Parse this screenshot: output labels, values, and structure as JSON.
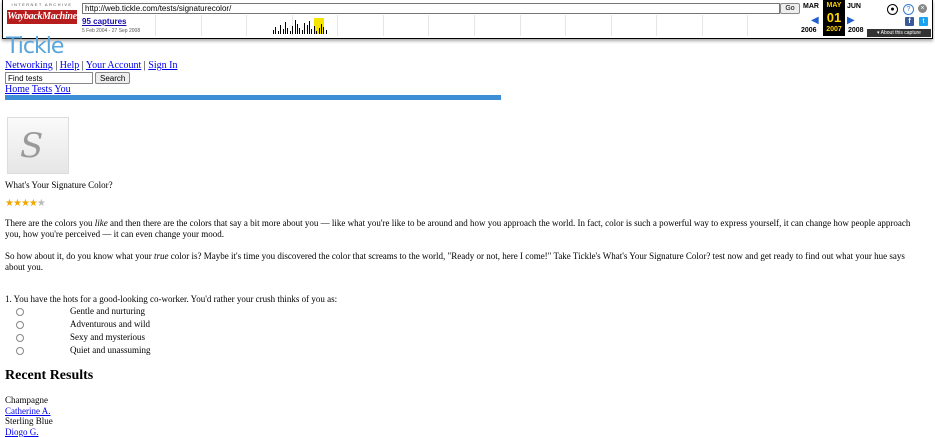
{
  "wayback": {
    "logo_top": "INTERNET ARCHIVE",
    "logo_main": "WaybackMachine",
    "url": "http://web.tickle.com/tests/signaturecolor/",
    "go_label": "Go",
    "captures": "95 captures",
    "date_range": "5 Feb 2004 - 27 Sep 2008",
    "prev_month": "MAR",
    "cur_month": "MAY",
    "cur_day": "01",
    "next_month": "JUN",
    "prev_year": "2006",
    "cur_year": "2007",
    "next_year": "2008",
    "about": "▾ About this capture"
  },
  "site": {
    "logo": "Tickle",
    "nav": [
      "Networking",
      "Help",
      "Your Account",
      "Sign In"
    ],
    "search_value": "Find tests",
    "search_button": "Search",
    "subnav": [
      "Home",
      "Tests",
      "You"
    ]
  },
  "test": {
    "title": "What's Your Signature Color?",
    "rating": 4,
    "rating_max": 5,
    "intro1_a": "There are the colors you ",
    "intro1_em": "like",
    "intro1_b": " and then there are the colors that say a bit more about you — like what you're like to be around and how you approach the world. In fact, color is such a powerful way to express yourself, it can change how people approach you, how you're perceived — it can even change your mood.",
    "intro2_a": "So how about it, do you know what your ",
    "intro2_em": "true",
    "intro2_b": " color is? Maybe it's time you discovered the color that screams to the world, \"Ready or not, here I come!\" Take Tickle's What's Your Signature Color? test now and get ready to find out what your hue says about you.",
    "question": "1. You have the hots for a good-looking co-worker. You'd rather your crush thinks of you as:",
    "options": [
      "Gentle and nurturing",
      "Adventurous and wild",
      "Sexy and mysterious",
      "Quiet and unassuming"
    ]
  },
  "recent": {
    "heading": "Recent Results",
    "items": [
      {
        "text": "Champagne",
        "link": false
      },
      {
        "text": "Catherine A.",
        "link": true
      },
      {
        "text": "Sterling Blue",
        "link": false
      },
      {
        "text": "Diogo G.",
        "link": true
      }
    ]
  }
}
